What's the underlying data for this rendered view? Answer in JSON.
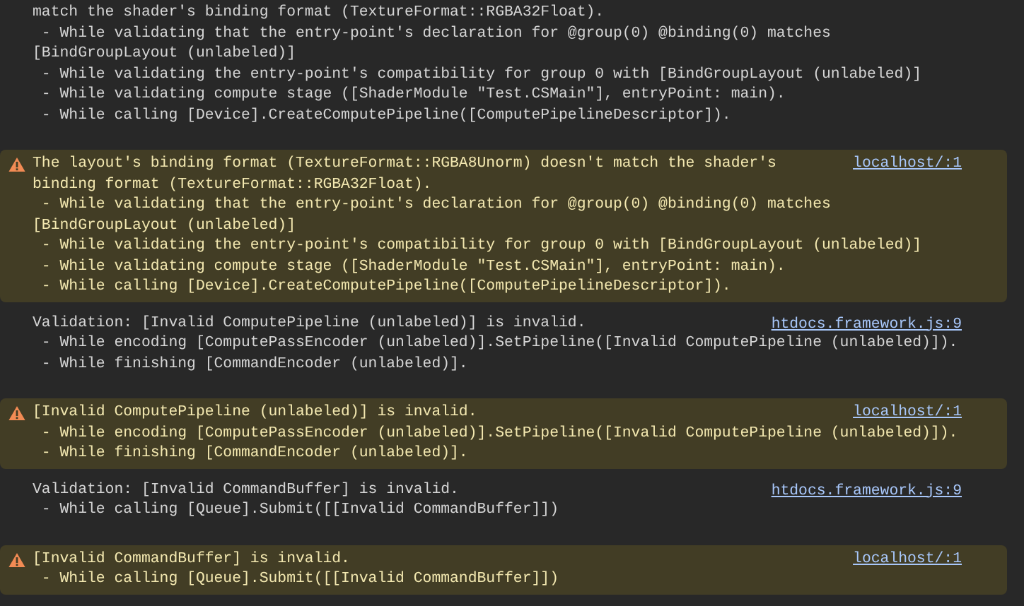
{
  "console": {
    "entries": [
      {
        "kind": "log",
        "lines": [
          "match the shader's binding format (TextureFormat::RGBA32Float).",
          " - While validating that the entry-point's declaration for @group(0) @binding(0) matches",
          "[BindGroupLayout (unlabeled)]",
          " - While validating the entry-point's compatibility for group 0 with [BindGroupLayout (unlabeled)]",
          " - While validating compute stage ([ShaderModule \"Test.CSMain\"], entryPoint: main).",
          " - While calling [Device].CreateComputePipeline([ComputePipelineDescriptor])."
        ]
      },
      {
        "kind": "warning",
        "source": "localhost/:1",
        "lines": [
          "The layout's binding format (TextureFormat::RGBA8Unorm) doesn't match the shader's",
          "binding format (TextureFormat::RGBA32Float).",
          " - While validating that the entry-point's declaration for @group(0) @binding(0) matches",
          "[BindGroupLayout (unlabeled)]",
          " - While validating the entry-point's compatibility for group 0 with [BindGroupLayout (unlabeled)]",
          " - While validating compute stage ([ShaderModule \"Test.CSMain\"], entryPoint: main).",
          " - While calling [Device].CreateComputePipeline([ComputePipelineDescriptor])."
        ]
      },
      {
        "kind": "log",
        "source": "htdocs.framework.js:9",
        "lines": [
          "Validation: [Invalid ComputePipeline (unlabeled)] is invalid.",
          " - While encoding [ComputePassEncoder (unlabeled)].SetPipeline([Invalid ComputePipeline (unlabeled)]).",
          " - While finishing [CommandEncoder (unlabeled)]."
        ]
      },
      {
        "kind": "warning",
        "source": "localhost/:1",
        "lines": [
          "[Invalid ComputePipeline (unlabeled)] is invalid.",
          " - While encoding [ComputePassEncoder (unlabeled)].SetPipeline([Invalid ComputePipeline (unlabeled)]).",
          " - While finishing [CommandEncoder (unlabeled)]."
        ]
      },
      {
        "kind": "log",
        "source": "htdocs.framework.js:9",
        "lines": [
          "Validation: [Invalid CommandBuffer] is invalid.",
          " - While calling [Queue].Submit([[Invalid CommandBuffer]])"
        ]
      },
      {
        "kind": "warning",
        "source": "localhost/:1",
        "lines": [
          "[Invalid CommandBuffer] is invalid.",
          " - While calling [Queue].Submit([[Invalid CommandBuffer]])"
        ]
      }
    ]
  }
}
